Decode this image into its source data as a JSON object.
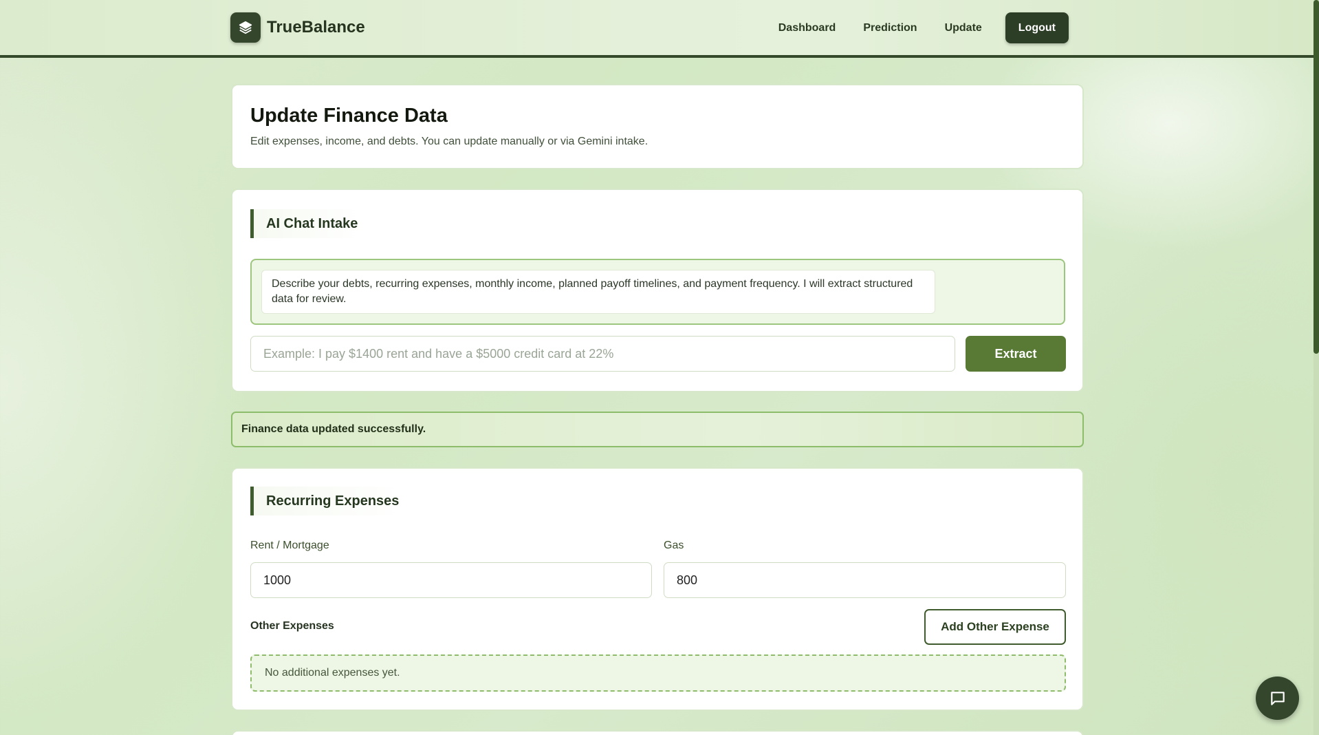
{
  "app": {
    "name": "TrueBalance",
    "logo_icon": "layers-icon"
  },
  "nav": {
    "links": [
      "Dashboard",
      "Prediction",
      "Update"
    ],
    "logout_label": "Logout"
  },
  "header_card": {
    "title": "Update Finance Data",
    "subtitle": "Edit expenses, income, and debts. You can update manually or via Gemini intake."
  },
  "ai_chat": {
    "heading": "AI Chat Intake",
    "assistant_message": "Describe your debts, recurring expenses, monthly income, planned payoff timelines, and payment frequency. I will extract structured data for review.",
    "input_placeholder": "Example: I pay $1400 rent and have a $5000 credit card at 22%",
    "input_value": "",
    "extract_label": "Extract"
  },
  "status": {
    "success_message": "Finance data updated successfully."
  },
  "recurring_expenses": {
    "heading": "Recurring Expenses",
    "rent_label": "Rent / Mortgage",
    "rent_value": "1000",
    "gas_label": "Gas",
    "gas_value": "800",
    "other_label": "Other Expenses",
    "add_other_label": "Add Other Expense",
    "empty_message": "No additional expenses yet."
  },
  "chat_fab_icon": "chat-bubble-icon",
  "colors": {
    "accent_dark": "#2c3e25",
    "accent_green": "#587a35",
    "success_border": "#8dbd6b"
  }
}
